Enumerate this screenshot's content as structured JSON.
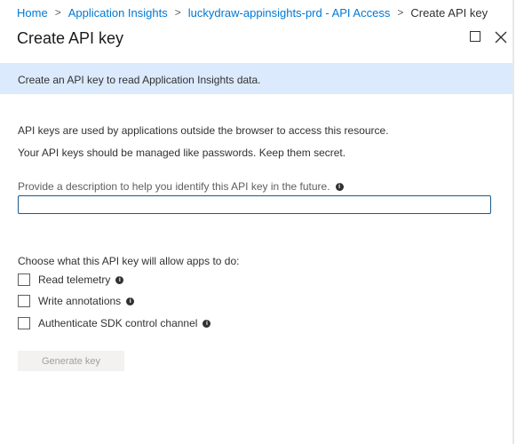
{
  "breadcrumb": {
    "items": [
      "Home",
      "Application Insights",
      "luckydraw-appinsights-prd - API Access"
    ],
    "current": "Create API key",
    "separator": ">"
  },
  "panel": {
    "title": "Create API key"
  },
  "banner": {
    "text": "Create an API key to read Application Insights data."
  },
  "info": {
    "line1": "API keys are used by applications outside the browser to access this resource.",
    "line2": "Your API keys should be managed like passwords. Keep them secret."
  },
  "description": {
    "label": "Provide a description to help you identify this API key in the future.",
    "value": "",
    "placeholder": ""
  },
  "permissions": {
    "heading": "Choose what this API key will allow apps to do:",
    "options": [
      {
        "label": "Read telemetry",
        "checked": false
      },
      {
        "label": "Write annotations",
        "checked": false
      },
      {
        "label": "Authenticate SDK control channel",
        "checked": false
      }
    ]
  },
  "actions": {
    "generate_label": "Generate key"
  },
  "colors": {
    "link": "#0078d4",
    "banner_bg": "#dbeafd",
    "input_border": "#1b5a8a",
    "button_bg": "#f3f2f1",
    "button_text": "#a19f9d"
  },
  "icons": {
    "maximize": "maximize-icon",
    "close": "close-icon",
    "info": "info-icon",
    "chevron": "chevron-right-icon"
  }
}
